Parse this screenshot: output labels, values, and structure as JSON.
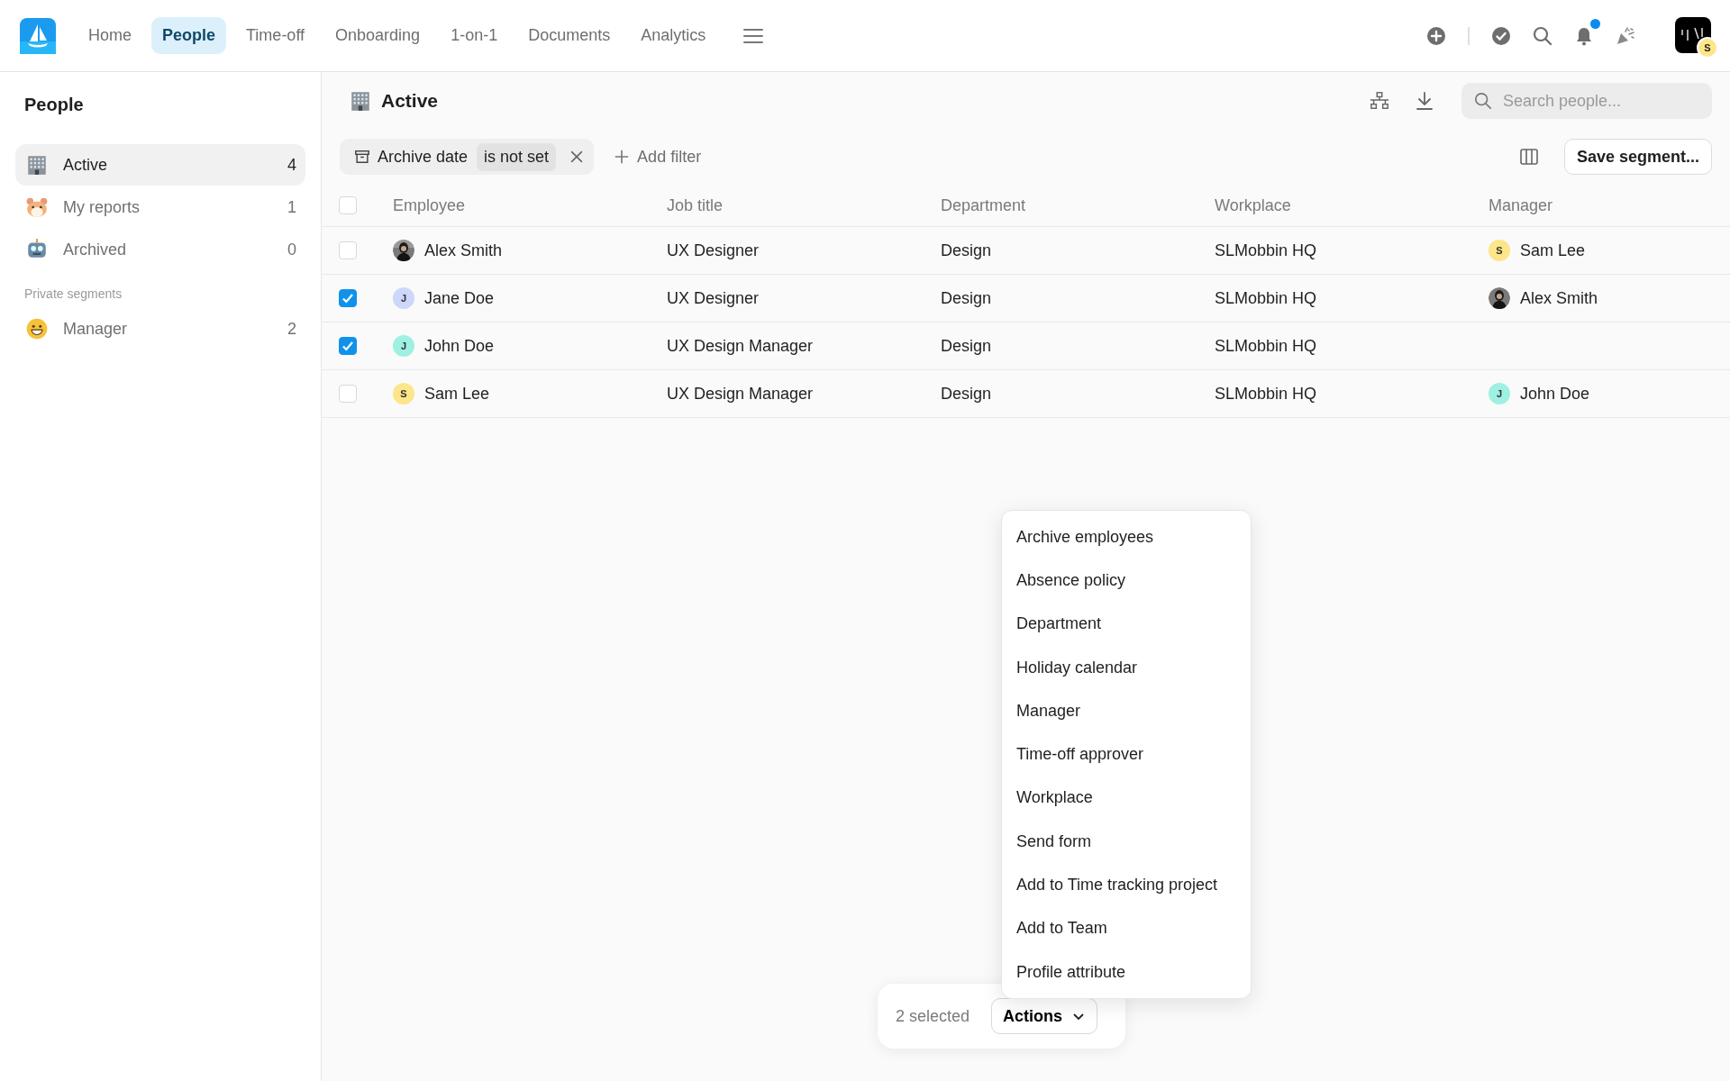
{
  "nav": {
    "tabs": [
      {
        "label": "Home",
        "selected": false
      },
      {
        "label": "People",
        "selected": true
      },
      {
        "label": "Time-off",
        "selected": false
      },
      {
        "label": "Onboarding",
        "selected": false
      },
      {
        "label": "1-on-1",
        "selected": false
      },
      {
        "label": "Documents",
        "selected": false
      },
      {
        "label": "Analytics",
        "selected": false
      }
    ],
    "unread_notifications": true,
    "account_badge": "S"
  },
  "sidebar": {
    "title": "People",
    "items": [
      {
        "label": "Active",
        "count": "4",
        "selected": true
      },
      {
        "label": "My reports",
        "count": "1",
        "selected": false
      },
      {
        "label": "Archived",
        "count": "0",
        "selected": false
      }
    ],
    "section_title": "Private segments",
    "segments": [
      {
        "label": "Manager",
        "count": "2",
        "selected": false
      }
    ]
  },
  "header": {
    "title": "Active",
    "search_placeholder": "Search people..."
  },
  "filter": {
    "field": "Archive date",
    "condition": "is not set",
    "add_label": "Add filter",
    "save_label": "Save segment..."
  },
  "table": {
    "columns": [
      "Employee",
      "Job title",
      "Department",
      "Workplace",
      "Manager"
    ],
    "all_selected": false,
    "rows": [
      {
        "selected": false,
        "employee": {
          "name": "Alex Smith"
        },
        "job_title": "UX Designer",
        "department": "Design",
        "workplace": "SLMobbin HQ",
        "manager": {
          "name": "Sam Lee",
          "avatar": {
            "kind": "initial",
            "initial": "S",
            "color": "#fde58a"
          }
        }
      },
      {
        "selected": true,
        "employee": {
          "name": "Jane Doe",
          "avatar": {
            "kind": "initial",
            "initial": "J",
            "color": "#cdd6fb"
          }
        },
        "job_title": "UX Designer",
        "department": "Design",
        "workplace": "SLMobbin HQ",
        "manager": {
          "name": "Alex Smith"
        }
      },
      {
        "selected": true,
        "employee": {
          "name": "John Doe",
          "avatar": {
            "kind": "initial",
            "initial": "J",
            "color": "#9ef0e2"
          }
        },
        "job_title": "UX Design Manager",
        "department": "Design",
        "workplace": "SLMobbin HQ"
      },
      {
        "selected": false,
        "employee": {
          "name": "Sam Lee",
          "avatar": {
            "kind": "initial",
            "initial": "S",
            "color": "#fde58a"
          }
        },
        "job_title": "UX Design Manager",
        "department": "Design",
        "workplace": "SLMobbin HQ",
        "manager": {
          "name": "John Doe",
          "avatar": {
            "kind": "initial",
            "initial": "J",
            "color": "#9ef0e2"
          }
        }
      }
    ]
  },
  "selection_bar": {
    "count_text": "2 selected",
    "actions_label": "Actions",
    "menu": [
      "Archive employees",
      "Absence policy",
      "Department",
      "Holiday calendar",
      "Manager",
      "Time-off approver",
      "Workplace",
      "Send form",
      "Add to Time tracking project",
      "Add to Team",
      "Profile attribute"
    ]
  }
}
